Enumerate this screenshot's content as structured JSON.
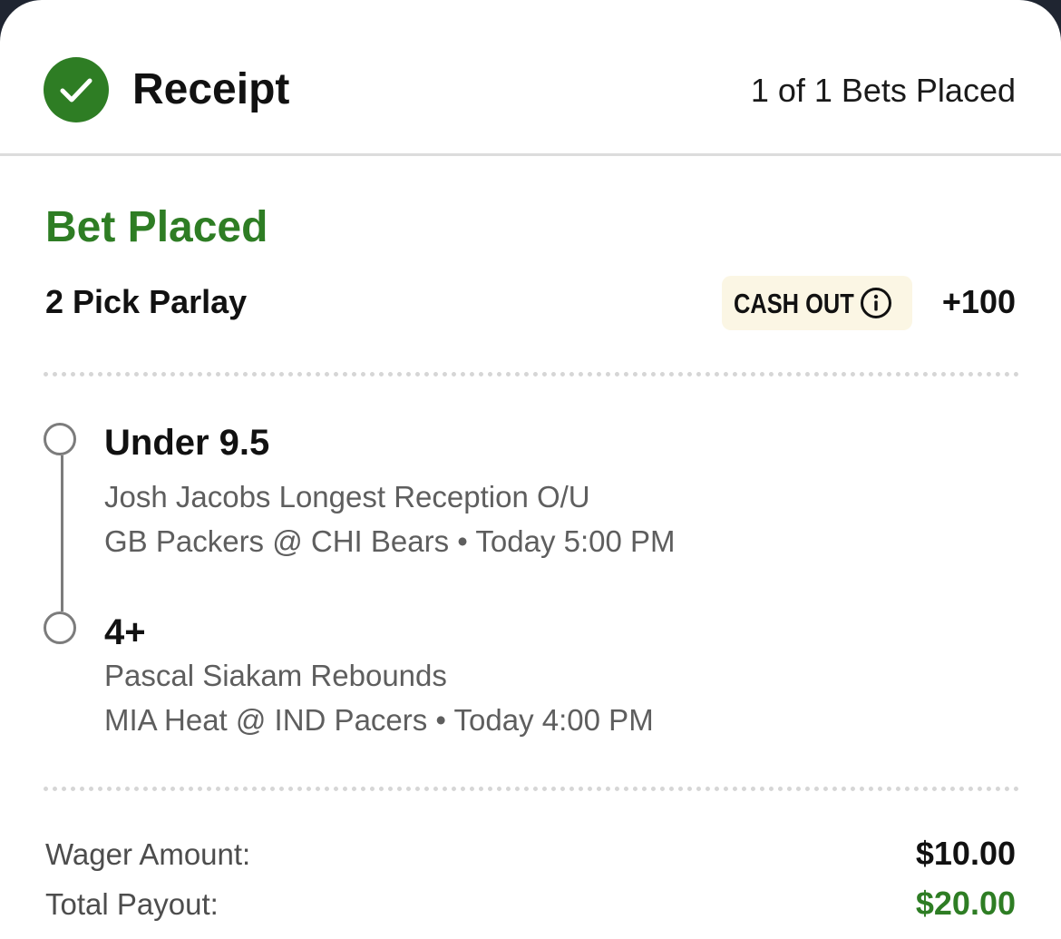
{
  "header": {
    "title": "Receipt",
    "bets_count": "1 of 1 Bets Placed"
  },
  "bet": {
    "status": "Bet Placed",
    "parlay_name": "2 Pick Parlay",
    "cashout_label": "CASH OUT",
    "odds": "+100",
    "legs": [
      {
        "pick": "Under 9.5",
        "market": "Josh Jacobs Longest Reception O/U",
        "game": "GB Packers @ CHI Bears • Today 5:00 PM"
      },
      {
        "pick": "4+",
        "market": "Pascal Siakam Rebounds",
        "game": "MIA Heat @ IND Pacers • Today 4:00 PM"
      }
    ]
  },
  "summary": {
    "wager_label": "Wager Amount:",
    "wager_value": "$10.00",
    "payout_label": "Total Payout:",
    "payout_value": "$20.00"
  },
  "colors": {
    "accent_green": "#2e7d24",
    "cashout_bg": "#fbf6e4",
    "backdrop": "#1f2531"
  },
  "icons": {
    "status": "check-circle-icon",
    "cashout_info": "info-icon",
    "leg_marker": "circle-outline-icon"
  }
}
